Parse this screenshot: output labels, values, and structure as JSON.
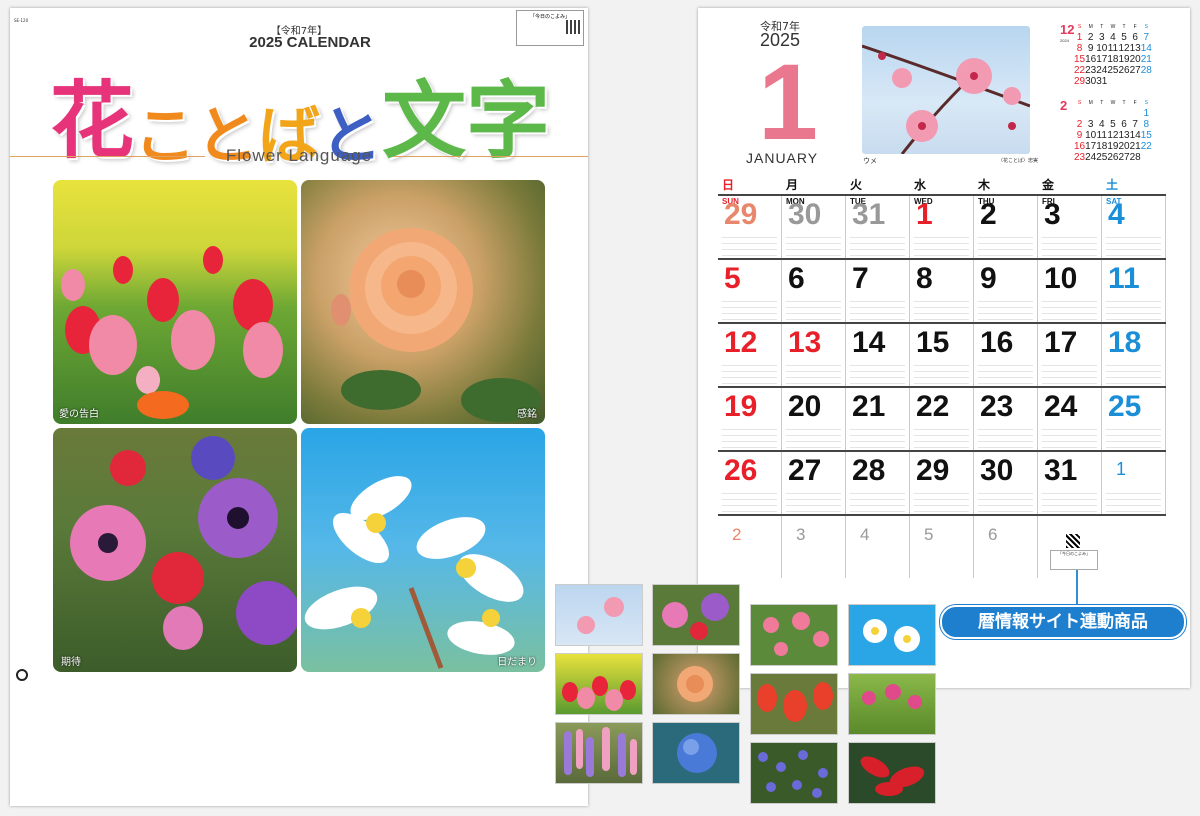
{
  "cover": {
    "code": "SE-120",
    "reiwa": "【令和7年】",
    "year_title": "2025 CALENDAR",
    "title_chars": [
      {
        "ch": "花",
        "color": "#e6337a",
        "size": 84
      },
      {
        "ch": "こ",
        "color": "#f08a1c",
        "size": 62
      },
      {
        "ch": "と",
        "color": "#f08a1c",
        "size": 62
      },
      {
        "ch": "ば",
        "color": "#f3a51a",
        "size": 62
      },
      {
        "ch": "と",
        "color": "#3d5fc4",
        "size": 62
      },
      {
        "ch": "文",
        "color": "#5db84a",
        "size": 84
      },
      {
        "ch": "字",
        "color": "#5db84a",
        "size": 84
      }
    ],
    "subtitle": "Flower Language",
    "qr_title": "「今日のこよみ」",
    "photos": [
      {
        "caption": "愛の告白"
      },
      {
        "caption": "感銘"
      },
      {
        "caption": "期待"
      },
      {
        "caption": "日だまり"
      }
    ]
  },
  "month": {
    "reiwa": "令和7年",
    "year": "2025",
    "month_number": "1",
    "month_name": "JANUARY",
    "photo_caption": "ウメ",
    "photo_caption_right": "〈花ことば〉忠実",
    "colors": {
      "sun": "#e8202a",
      "sat": "#1b8ed8",
      "weekday": "#111111",
      "prev": "#e8876b",
      "other": "#999999"
    },
    "weekdays": [
      {
        "jp": "日",
        "en": "SUN"
      },
      {
        "jp": "月",
        "en": "MON"
      },
      {
        "jp": "火",
        "en": "TUE"
      },
      {
        "jp": "水",
        "en": "WED"
      },
      {
        "jp": "木",
        "en": "THU"
      },
      {
        "jp": "金",
        "en": "FRI"
      },
      {
        "jp": "土",
        "en": "SAT"
      }
    ],
    "weeks": [
      [
        [
          "29",
          "prev-sun"
        ],
        [
          "30",
          "other"
        ],
        [
          "31",
          "other"
        ],
        [
          "1",
          "sun"
        ],
        [
          "2",
          "wk"
        ],
        [
          "3",
          "wk"
        ],
        [
          "4",
          "sat"
        ]
      ],
      [
        [
          "5",
          "sun"
        ],
        [
          "6",
          "wk"
        ],
        [
          "7",
          "wk"
        ],
        [
          "8",
          "wk"
        ],
        [
          "9",
          "wk"
        ],
        [
          "10",
          "wk"
        ],
        [
          "11",
          "sat"
        ]
      ],
      [
        [
          "12",
          "sun"
        ],
        [
          "13",
          "sun"
        ],
        [
          "14",
          "wk"
        ],
        [
          "15",
          "wk"
        ],
        [
          "16",
          "wk"
        ],
        [
          "17",
          "wk"
        ],
        [
          "18",
          "sat"
        ]
      ],
      [
        [
          "19",
          "sun"
        ],
        [
          "20",
          "wk"
        ],
        [
          "21",
          "wk"
        ],
        [
          "22",
          "wk"
        ],
        [
          "23",
          "wk"
        ],
        [
          "24",
          "wk"
        ],
        [
          "25",
          "sat"
        ]
      ],
      [
        [
          "26",
          "sun"
        ],
        [
          "27",
          "wk"
        ],
        [
          "28",
          "wk"
        ],
        [
          "29",
          "wk"
        ],
        [
          "30",
          "wk"
        ],
        [
          "31",
          "wk"
        ],
        [
          "1",
          "sat-next"
        ]
      ]
    ],
    "next_row": [
      "2",
      "3",
      "4",
      "5",
      "6"
    ],
    "mini_prev": {
      "month": "12",
      "year": "2024",
      "head": [
        "S",
        "M",
        "T",
        "W",
        "T",
        "F",
        "S"
      ],
      "rows": [
        [
          "1",
          "2",
          "3",
          "4",
          "5",
          "6",
          "7"
        ],
        [
          "8",
          "9",
          "10",
          "11",
          "12",
          "13",
          "14"
        ],
        [
          "15",
          "16",
          "17",
          "18",
          "19",
          "20",
          "21"
        ],
        [
          "22",
          "23",
          "24",
          "25",
          "26",
          "27",
          "28"
        ],
        [
          "29",
          "30",
          "31",
          "",
          "",
          "",
          ""
        ]
      ]
    },
    "mini_next": {
      "month": "2",
      "head": [
        "S",
        "M",
        "T",
        "W",
        "T",
        "F",
        "S"
      ],
      "rows": [
        [
          "",
          "",
          "",
          "",
          "",
          "",
          "1"
        ],
        [
          "2",
          "3",
          "4",
          "5",
          "6",
          "7",
          "8"
        ],
        [
          "9",
          "10",
          "11",
          "12",
          "13",
          "14",
          "15"
        ],
        [
          "16",
          "17",
          "18",
          "19",
          "20",
          "21",
          "22"
        ],
        [
          "23",
          "24",
          "25",
          "26",
          "27",
          "28",
          ""
        ]
      ]
    },
    "qr_label": "「今日のこよみ」",
    "callout": "暦情報サイト連動商品"
  }
}
